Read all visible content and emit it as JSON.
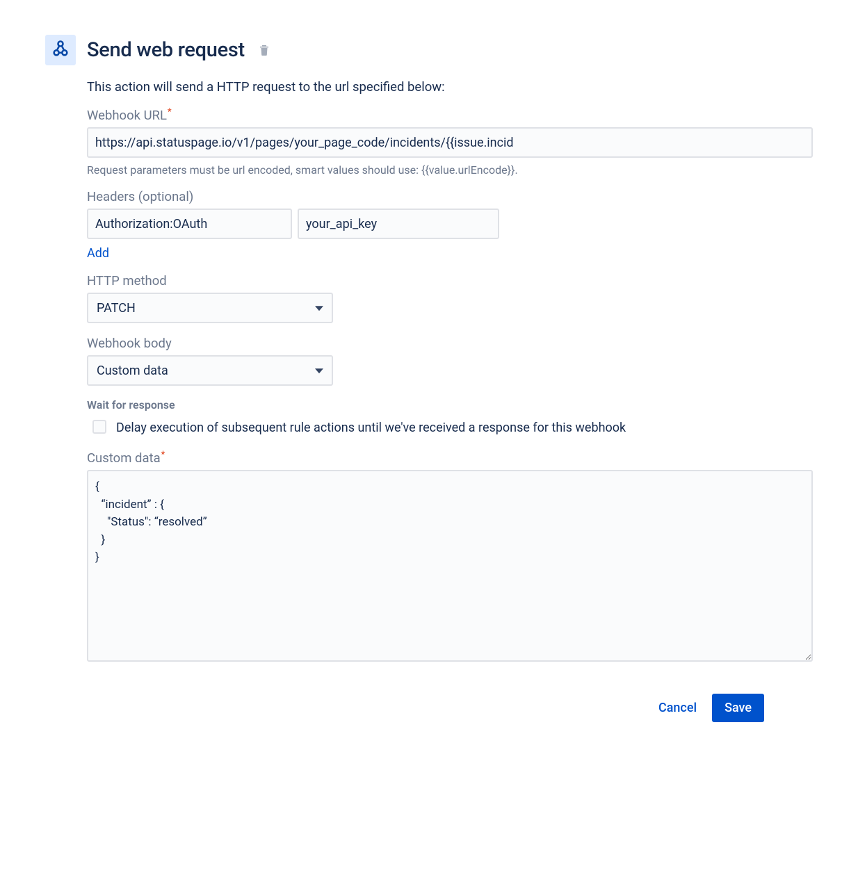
{
  "header": {
    "title": "Send web request"
  },
  "description": "This action will send a HTTP request to the url specified below:",
  "webhookUrl": {
    "label": "Webhook URL",
    "value": "https://api.statuspage.io/v1/pages/your_page_code/incidents/{{issue.incid",
    "helpText": "Request parameters must be url encoded, smart values should use: {{value.urlEncode}}."
  },
  "headers": {
    "label": "Headers (optional)",
    "keyValue": {
      "key": "Authorization:OAuth",
      "value": "your_api_key"
    },
    "addLabel": "Add"
  },
  "httpMethod": {
    "label": "HTTP method",
    "value": "PATCH"
  },
  "webhookBody": {
    "label": "Webhook body",
    "value": "Custom data"
  },
  "waitForResponse": {
    "sectionLabel": "Wait for response",
    "checkboxLabel": "Delay execution of subsequent rule actions until we've received a response for this webhook"
  },
  "customData": {
    "label": "Custom data",
    "value": "{\n  “incident” : {\n    \"Status\": “resolved”\n  }\n}"
  },
  "footer": {
    "cancel": "Cancel",
    "save": "Save"
  }
}
